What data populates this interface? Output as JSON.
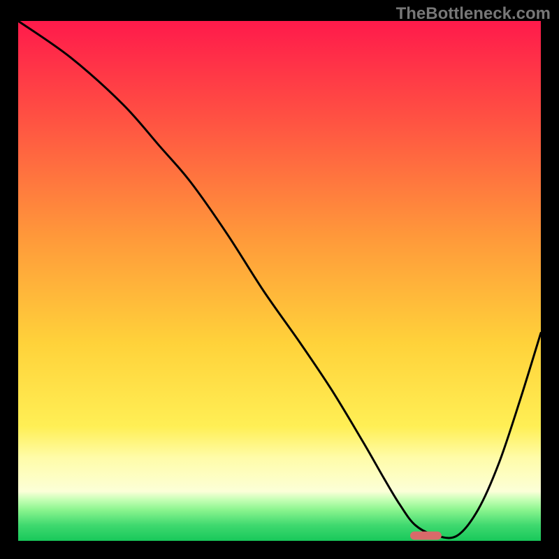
{
  "watermark": "TheBottleneck.com",
  "chart_data": {
    "type": "line",
    "title": "",
    "xlabel": "",
    "ylabel": "",
    "xlim": [
      0,
      100
    ],
    "ylim": [
      0,
      100
    ],
    "grid": false,
    "legend": false,
    "background": {
      "type": "vertical-gradient",
      "description": "red at top through orange, yellow, pale-yellow band, green at bottom",
      "stops": [
        {
          "pos": 0,
          "color": "#ff1a4b"
        },
        {
          "pos": 18,
          "color": "#ff4f43"
        },
        {
          "pos": 42,
          "color": "#ff9a3a"
        },
        {
          "pos": 62,
          "color": "#ffd23a"
        },
        {
          "pos": 78,
          "color": "#ffef55"
        },
        {
          "pos": 84,
          "color": "#fffca8"
        },
        {
          "pos": 90.5,
          "color": "#fcffd8"
        },
        {
          "pos": 92,
          "color": "#c8ffb7"
        },
        {
          "pos": 94,
          "color": "#8cf58f"
        },
        {
          "pos": 97,
          "color": "#3fd96f"
        },
        {
          "pos": 100,
          "color": "#18c85a"
        }
      ]
    },
    "series": [
      {
        "name": "bottleneck-curve",
        "color": "#000000",
        "x": [
          0,
          10,
          20,
          27,
          33,
          40,
          47,
          54,
          60,
          66,
          70,
          73,
          76,
          80,
          84,
          88,
          92,
          96,
          100
        ],
        "y": [
          100,
          93,
          84,
          76,
          69,
          59,
          48,
          38,
          29,
          19,
          12,
          7,
          3,
          1,
          1,
          6,
          15,
          27,
          40
        ]
      }
    ],
    "marker": {
      "name": "optimal-point",
      "shape": "rounded-rect",
      "color": "#d96a6a",
      "x": 78,
      "y": 1,
      "width_pct": 6,
      "height_pct": 1.6
    }
  }
}
